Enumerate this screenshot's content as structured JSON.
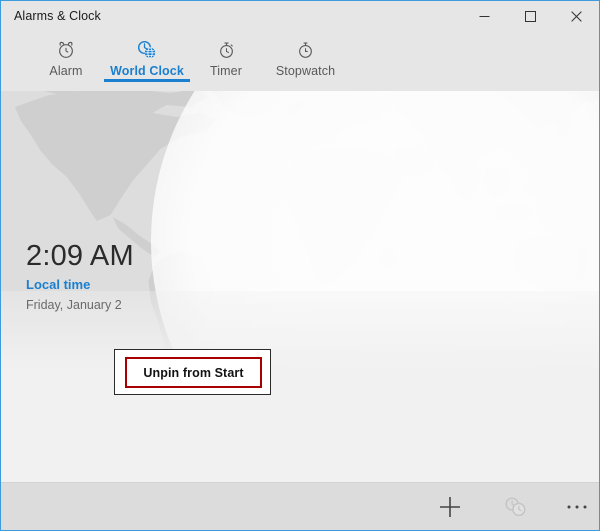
{
  "window": {
    "title": "Alarms & Clock",
    "accent_color": "#1b7fd0",
    "border_color": "#3c9add",
    "chrome_color": "#e6e6e6",
    "controls": [
      {
        "name": "minimize",
        "glyph": "minimize-icon",
        "tooltip": "Minimize"
      },
      {
        "name": "maximize",
        "glyph": "maximize-icon",
        "tooltip": "Maximize"
      },
      {
        "name": "close",
        "glyph": "close-icon",
        "tooltip": "Close"
      }
    ]
  },
  "tabs": [
    {
      "id": "alarm",
      "label": "Alarm",
      "icon": "alarm-clock-icon",
      "active": false
    },
    {
      "id": "worldclock",
      "label": "World Clock",
      "icon": "world-clock-icon",
      "active": true
    },
    {
      "id": "timer",
      "label": "Timer",
      "icon": "timer-icon",
      "active": false
    },
    {
      "id": "stopwatch",
      "label": "Stopwatch",
      "icon": "stopwatch-icon",
      "active": false
    }
  ],
  "clock": {
    "time": "2:09 AM",
    "label": "Local time",
    "date": "Friday, January 2",
    "time_color": "#2b2b2b",
    "label_color": "#1b7fd0",
    "date_color": "#6a6a6a"
  },
  "context_menu": {
    "items": [
      {
        "label": "Unpin from Start",
        "highlighted": true
      }
    ],
    "highlight_color": "#a80000",
    "background": "#ffffff",
    "border_color": "#2b2b2b"
  },
  "app_bar": [
    {
      "id": "add",
      "icon": "plus-icon",
      "label": "Add new city",
      "enabled": true
    },
    {
      "id": "compare",
      "icon": "compare-clocks-icon",
      "label": "Compare",
      "enabled": false
    },
    {
      "id": "more",
      "icon": "more-ellipsis-icon",
      "label": "See more",
      "enabled": true
    }
  ],
  "map": {
    "type": "world-map",
    "land_color": "#cfcfcf",
    "ocean_color": "#dddddd",
    "daylight_overlay": true
  }
}
